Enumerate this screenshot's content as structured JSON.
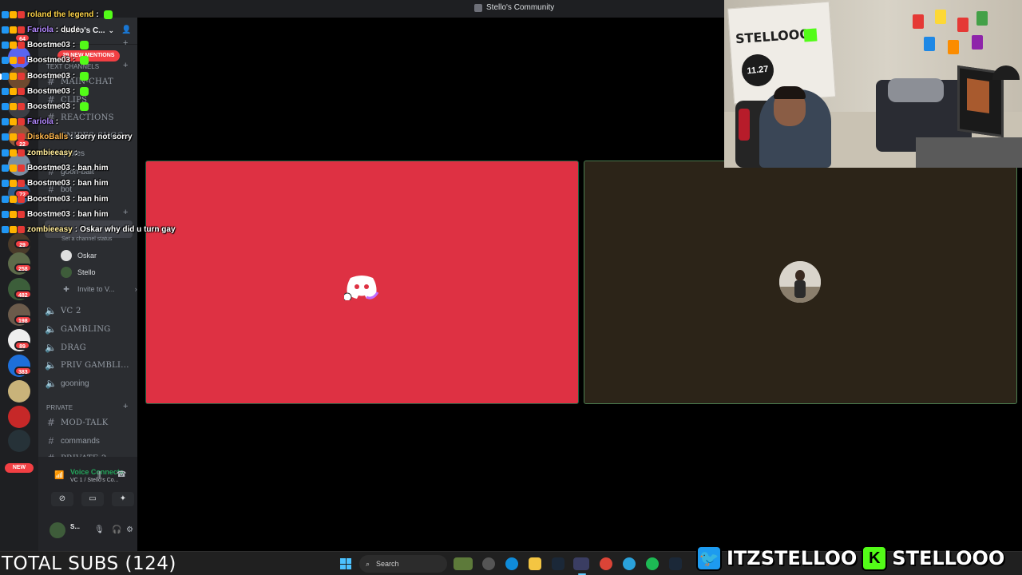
{
  "window": {
    "title": "Stello's Community"
  },
  "server": {
    "name": "Stello's C...",
    "mentions_pill": "29 NEW MENTIONS",
    "new_pill": "NEW"
  },
  "rail": {
    "badges": [
      {
        "count": "64"
      },
      {
        "count": "22"
      },
      {
        "count": "72"
      },
      {
        "count": "29"
      },
      {
        "count": "258"
      },
      {
        "count": "482"
      },
      {
        "count": "198"
      },
      {
        "count": "89"
      },
      {
        "count": "383"
      }
    ]
  },
  "sidebar": {
    "categories": [
      {
        "label": "text channels"
      },
      {
        "label": "PRIVATE"
      }
    ],
    "channels": [
      {
        "label": "MAIN-CHAT"
      },
      {
        "label": "CLIPS"
      },
      {
        "label": "REACTIONS"
      },
      {
        "label": "SNIPES-SUGG..."
      },
      {
        "label": "quotes"
      },
      {
        "label": "goon-bait"
      },
      {
        "label": "bot"
      }
    ],
    "status_hint": "Set a channel status",
    "vc_users": [
      {
        "name": "Oskar"
      },
      {
        "name": "Stello"
      }
    ],
    "invite": "Invite to V...",
    "voice_channels": [
      {
        "label": "VC 2"
      },
      {
        "label": "GAMBLING"
      },
      {
        "label": "DRAG"
      },
      {
        "label": "PRIV GAMBLI..."
      },
      {
        "label": "gooning"
      }
    ],
    "private_channels": [
      {
        "label": "MOD-TALK"
      },
      {
        "label": "commands"
      },
      {
        "label": "PRIVATE 2"
      }
    ]
  },
  "userpanel": {
    "voice_status": "Voice Connecte",
    "voice_sub": "VC 1 / Stello's Co...",
    "user_short": "S..."
  },
  "chat": [
    {
      "user": "roland the legend",
      "text": "",
      "user_color": "#ffd54a",
      "emote": true
    },
    {
      "user": "Fariola",
      "text": "dude",
      "user_color": "#b388ff",
      "emote": false
    },
    {
      "user": "Boostme03",
      "text": "",
      "user_color": "#ffffff",
      "emote": true
    },
    {
      "user": "Boostme03",
      "text": "",
      "user_color": "#ffffff",
      "emote": true
    },
    {
      "user": "Boostme03",
      "text": "",
      "user_color": "#ffffff",
      "emote": true
    },
    {
      "user": "Boostme03",
      "text": "",
      "user_color": "#ffffff",
      "emote": true
    },
    {
      "user": "Boostme03",
      "text": "",
      "user_color": "#ffffff",
      "emote": true
    },
    {
      "user": "Fariola",
      "text": "",
      "user_color": "#b388ff",
      "emote": false
    },
    {
      "user": "DiskoBalls",
      "text": "sorry not sorry",
      "user_color": "#ffb74d",
      "emote": false
    },
    {
      "user": "zombieeasy",
      "text": "",
      "user_color": "#ffeb99",
      "emote": false
    },
    {
      "user": "Boostme03",
      "text": "ban him",
      "user_color": "#ffffff",
      "emote": false
    },
    {
      "user": "Boostme03",
      "text": "ban him",
      "user_color": "#ffffff",
      "emote": false
    },
    {
      "user": "Boostme03",
      "text": "ban him",
      "user_color": "#ffffff",
      "emote": false
    },
    {
      "user": "Boostme03",
      "text": "ban him",
      "user_color": "#ffffff",
      "emote": false
    },
    {
      "user": "zombieeasy",
      "text": "Oskar why did u turn gay",
      "user_color": "#ffeb99",
      "emote": false
    }
  ],
  "overlay": {
    "total_subs": "TOTAL SUBS (124)",
    "twitter_handle": "ITZSTELLOO",
    "kick_handle": "STELLOOO"
  },
  "cam": {
    "board_text": "STELLOOO",
    "circle_text": "11.27"
  },
  "taskbar": {
    "search_placeholder": "Search"
  },
  "colors": {
    "discord_red": "#de3143",
    "kick_green": "#53fc18",
    "twitter_blue": "#1d9bf0",
    "voice_green": "#23a55a"
  }
}
